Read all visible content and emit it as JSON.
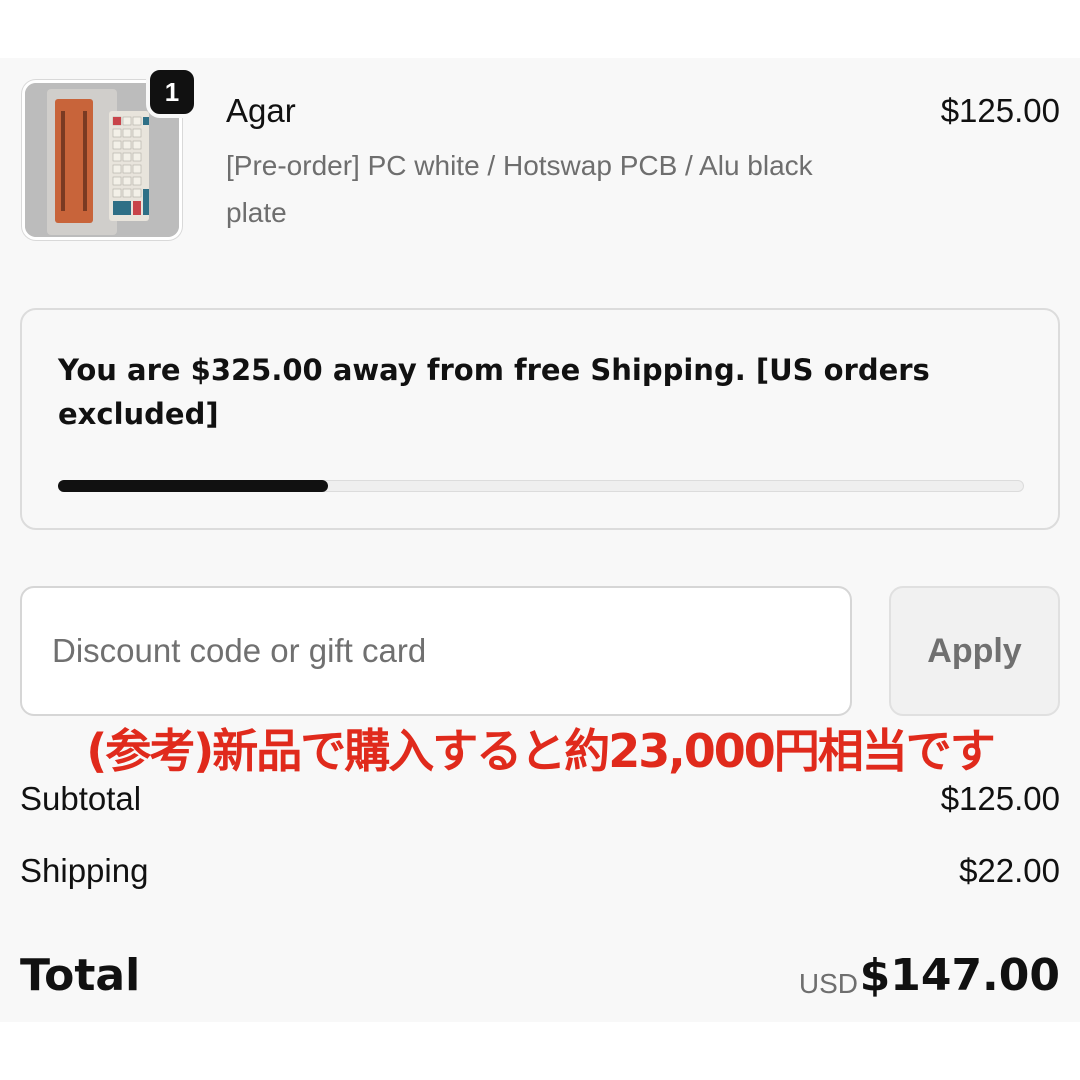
{
  "cart_item": {
    "quantity_badge": "1",
    "name": "Agar",
    "variant": "[Pre-order] PC white / Hotswap PCB / Alu black plate",
    "price": "$125.00",
    "thumbnail_icon": "keyboard-product-photo"
  },
  "shipping_progress": {
    "message": "You are $325.00 away from free Shipping. [US orders excluded]",
    "progress_fraction": 0.28
  },
  "discount": {
    "placeholder": "Discount code or gift card",
    "value": "",
    "apply_label": "Apply"
  },
  "note": {
    "text": "(参考)新品で購入すると約23,000円相当です",
    "color": "#e02a1c"
  },
  "summary": {
    "subtotal_label": "Subtotal",
    "subtotal_value": "$125.00",
    "shipping_label": "Shipping",
    "shipping_value": "$22.00",
    "total_label": "Total",
    "total_currency": "USD",
    "total_value": "$147.00"
  }
}
